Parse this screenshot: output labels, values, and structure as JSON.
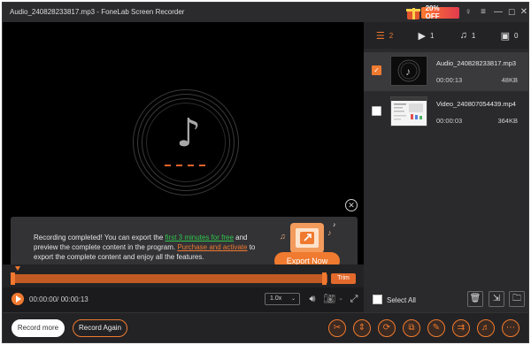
{
  "window": {
    "title": "Audio_240828233817.mp3  -  FoneLab Screen Recorder",
    "promo_label": "20% OFF",
    "controls": {
      "key": "♀",
      "menu": "≡",
      "minimize": "—",
      "maximize": "☐",
      "close": "✕"
    }
  },
  "overlay": {
    "message_part1": "Recording completed! You can export the ",
    "link_free": "first 3 minutes for free",
    "message_part2": " and preview the complete content in the program. ",
    "link_purchase": "Purchase and activate",
    "message_part3": " to export the complete content and enjoy all the features.",
    "export_button": "Export Now",
    "close_symbol": "✕"
  },
  "timeline": {
    "trim_label": "Trim"
  },
  "playback": {
    "time": "00:00:00/ 00:00:13",
    "speed": "1.0x",
    "speed_caret": "⌄"
  },
  "filter_tabs": [
    {
      "name": "all",
      "icon": "☰",
      "count": "2"
    },
    {
      "name": "video",
      "icon": "▶",
      "count": "1"
    },
    {
      "name": "audio",
      "icon": "♫",
      "count": "1"
    },
    {
      "name": "image",
      "icon": "▣",
      "count": "0"
    }
  ],
  "files": [
    {
      "name": "Audio_240828233817.mp3",
      "duration": "00:00:13",
      "size": "48KB",
      "checked": true,
      "check_mark": "✓"
    },
    {
      "name": "Video_240807054439.mp4",
      "duration": "00:00:03",
      "size": "364KB",
      "checked": false,
      "check_mark": ""
    }
  ],
  "list_footer": {
    "select_all": "Select All"
  },
  "bottom": {
    "record_more": "Record more",
    "record_again": "Record Again"
  },
  "colors": {
    "accent": "#f07a2f",
    "link_green": "#2ec74a",
    "background": "#1b1b1d"
  }
}
